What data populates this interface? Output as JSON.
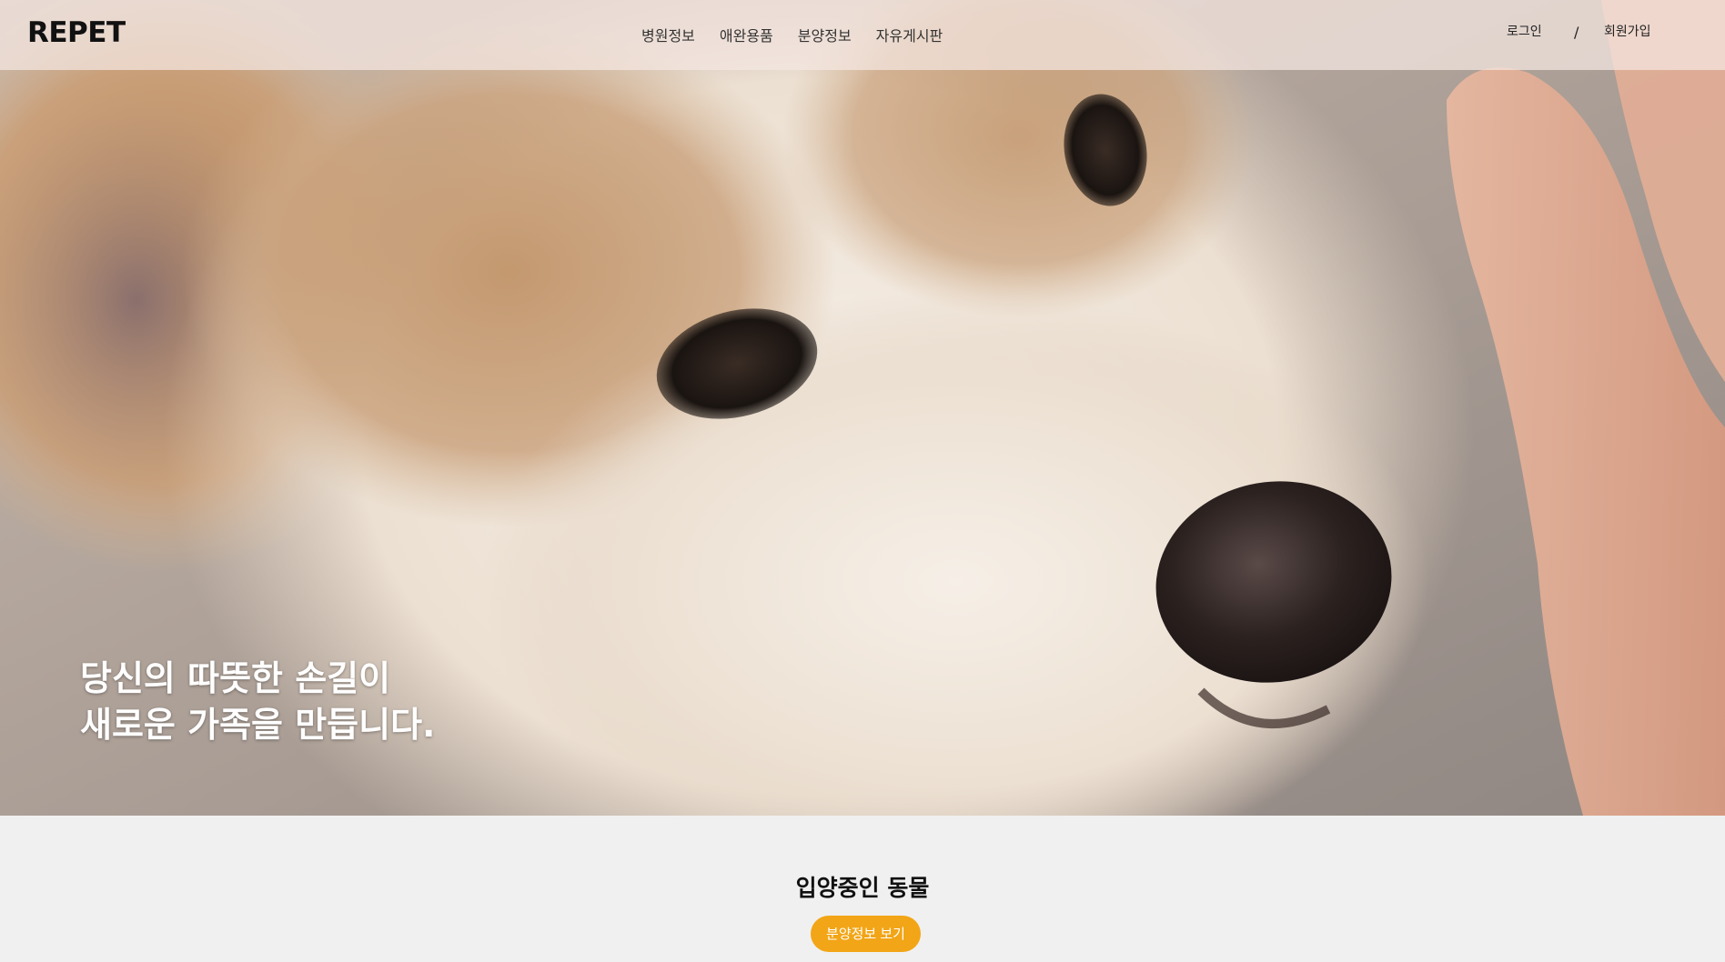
{
  "header": {
    "logo": "REPET",
    "nav": [
      {
        "label": "병원정보"
      },
      {
        "label": "애완용품"
      },
      {
        "label": "분양정보"
      },
      {
        "label": "자유게시판"
      }
    ],
    "auth": {
      "login": "로그인",
      "separator": "/",
      "signup": "회원가입"
    }
  },
  "hero": {
    "line1": "당신의 따뜻한 손길이",
    "line2": "새로운 가족을 만듭니다."
  },
  "adoption": {
    "title": "입양중인 동물",
    "button": "분양정보 보기"
  },
  "colors": {
    "accent": "#f2a516",
    "header_bg": "#f5e8e2",
    "section_bg": "#f0f0f0"
  }
}
